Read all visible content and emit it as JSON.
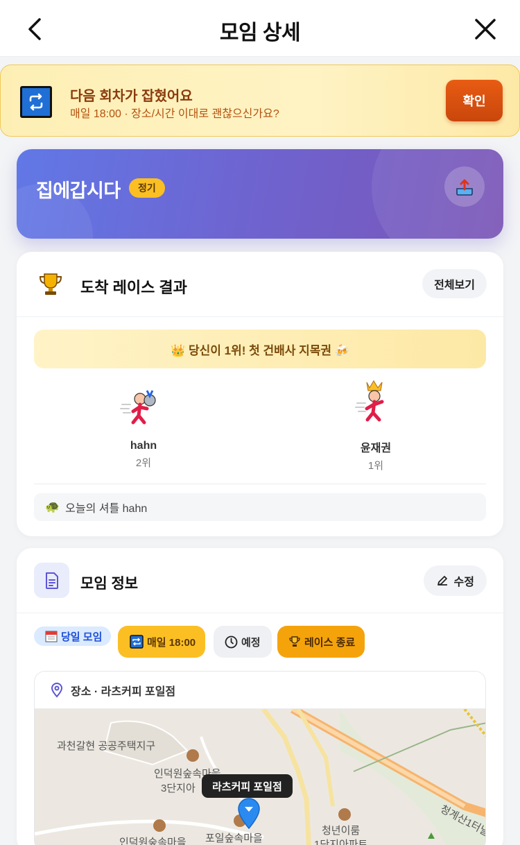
{
  "header": {
    "title": "모임 상세"
  },
  "notice": {
    "title": "다음 회차가 잡혔어요",
    "subtitle": "매일 18:00 · 장소/시간 이대로 괜찮으신가요?",
    "confirm_label": "확인"
  },
  "group": {
    "name": "집에갑시다",
    "badge": "정기"
  },
  "race": {
    "title": "도착 레이스 결과",
    "view_all_label": "전체보기",
    "winner_message": "👑 당신이 1위! 첫 건배사 지목권 🍻",
    "runners": [
      {
        "name": "hahn",
        "rank": "2위"
      },
      {
        "name": "윤재권",
        "rank": "1위"
      }
    ],
    "shuttle_text": "오늘의 셔틀 hahn"
  },
  "info": {
    "title": "모임 정보",
    "edit_label": "수정",
    "chips": [
      "당일 모임",
      "매일 18:00",
      "예정",
      "레이스 종료"
    ],
    "location_label": "장소 · 라츠커피 포일점",
    "map": {
      "pin_label": "라츠커피 포일점",
      "labels": [
        "과천갈현 공공주택지구",
        "인덕원숲속마을",
        "3단지아",
        "포일숲속마을",
        "인덕원숲속마을",
        "청년이룸",
        "1단지아파트",
        "청계산1터널"
      ]
    }
  },
  "colors": {
    "accent": "#e85c13",
    "hero_start": "#6178e6",
    "hero_end": "#7a55b6",
    "race_gold": "#fbbf24"
  }
}
